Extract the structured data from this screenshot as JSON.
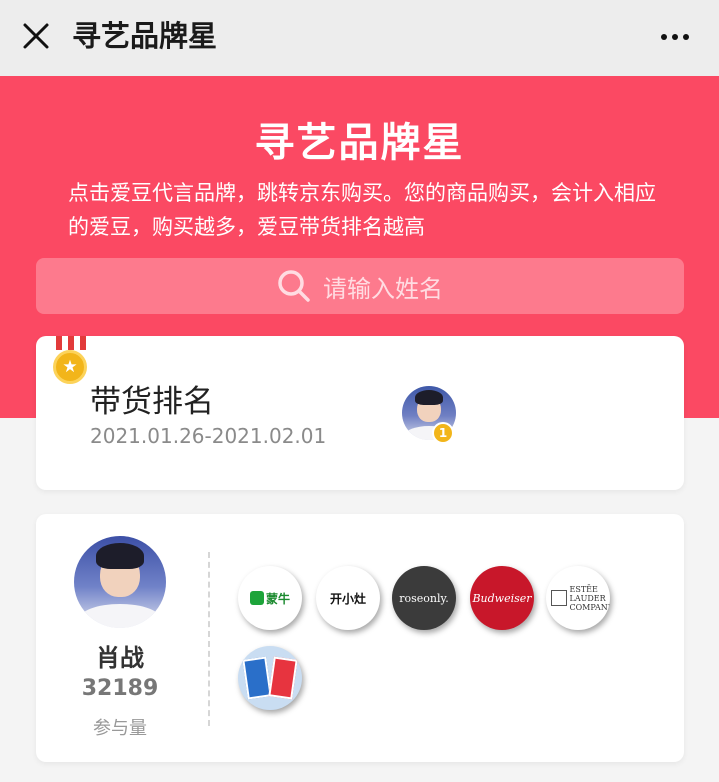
{
  "titlebar": {
    "title": "寻艺品牌星",
    "close_icon": "close-icon",
    "more_icon": "more-dots-icon"
  },
  "hero": {
    "title": "寻艺品牌星",
    "description": "点击爱豆代言品牌，跳转京东购买。您的商品购买，会计入相应的爱豆，购买越多，爱豆带货排名越高",
    "background_color": "#fb4963"
  },
  "search": {
    "placeholder": "请输入姓名",
    "icon": "search-icon"
  },
  "ranking": {
    "title": "带货排名",
    "dates": "2021.01.26-2021.02.01",
    "top_rank_badge": "1"
  },
  "idol": {
    "name": "肖战",
    "count": "32189",
    "count_label": "参与量",
    "brands": [
      {
        "label": "蒙牛"
      },
      {
        "label": "开小灶"
      },
      {
        "label": "roseonly."
      },
      {
        "label": "Budweiser"
      },
      {
        "label": "ESTĒE LAUDER COMPANIES"
      },
      {
        "label": ""
      }
    ]
  }
}
